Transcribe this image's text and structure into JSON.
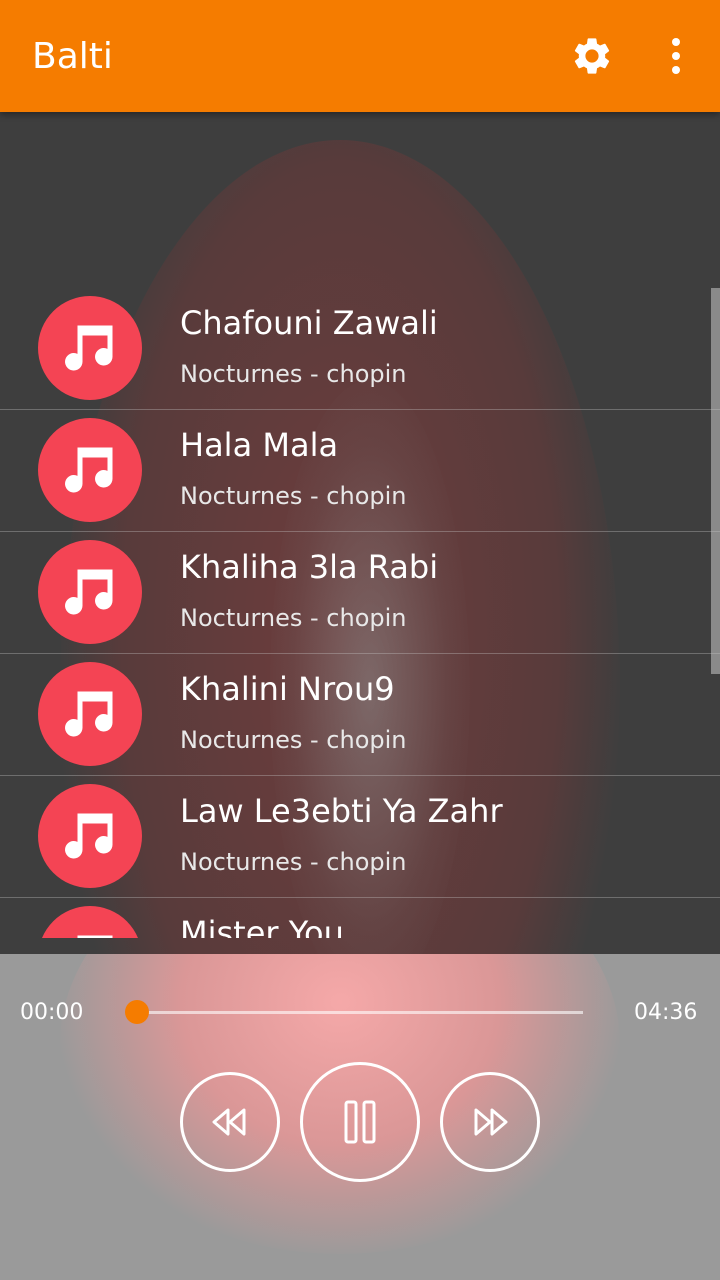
{
  "app": {
    "title": "Balti"
  },
  "toolbar": {
    "settings_icon": "gear-icon",
    "more_icon": "more-vert-icon"
  },
  "songs": [
    {
      "title": "Chafouni Zawali",
      "subtitle": "Nocturnes - chopin",
      "icon": "music-note-icon"
    },
    {
      "title": "Hala Mala",
      "subtitle": "Nocturnes - chopin",
      "icon": "music-note-icon"
    },
    {
      "title": "Khaliha 3la Rabi",
      "subtitle": "Nocturnes - chopin",
      "icon": "music-note-icon"
    },
    {
      "title": "Khalini Nrou9",
      "subtitle": "Nocturnes - chopin",
      "icon": "music-note-icon"
    },
    {
      "title": "Law Le3ebti Ya Zahr",
      "subtitle": "Nocturnes - chopin",
      "icon": "music-note-icon"
    },
    {
      "title": "Mister You",
      "subtitle": "",
      "icon": "music-note-icon"
    }
  ],
  "player": {
    "current_time": "00:00",
    "total_time": "04:36",
    "progress": 0,
    "controls": [
      "rewind",
      "pause",
      "fast-forward"
    ]
  },
  "colors": {
    "accent": "#f57c00",
    "icon_bg": "#f44454"
  }
}
